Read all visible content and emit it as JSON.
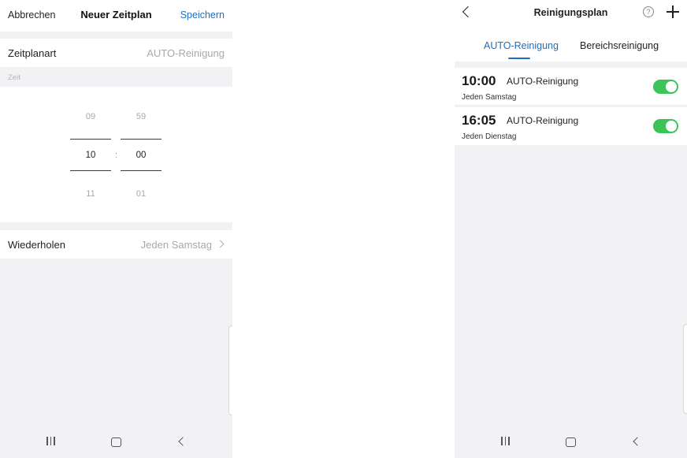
{
  "left": {
    "header": {
      "cancel": "Abbrechen",
      "title": "Neuer Zeitplan",
      "save": "Speichern"
    },
    "schedule_type": {
      "label": "Zeitplanart",
      "value": "AUTO-Reinigung"
    },
    "time_section_label": "Zeit",
    "time_picker": {
      "hours": {
        "prev": "09",
        "selected": "10",
        "next": "11"
      },
      "separator": ":",
      "minutes": {
        "prev": "59",
        "selected": "00",
        "next": "01"
      }
    },
    "repeat": {
      "label": "Wiederholen",
      "value": "Jeden Samstag"
    }
  },
  "right": {
    "header": {
      "title": "Reinigungsplan",
      "help_symbol": "?"
    },
    "tabs": [
      {
        "label": "AUTO-Reinigung",
        "active": true
      },
      {
        "label": "Bereichsreinigung",
        "active": false
      }
    ],
    "schedules": [
      {
        "time": "10:00",
        "mode": "AUTO-Reinigung",
        "repeat": "Jeden Samstag",
        "enabled": true
      },
      {
        "time": "16:05",
        "mode": "AUTO-Reinigung",
        "repeat": "Jeden Dienstag",
        "enabled": true
      }
    ]
  },
  "colors": {
    "accent": "#1f6fbf",
    "toggle_on": "#3cc45a",
    "background_gray": "#f2f2f4"
  },
  "icons": [
    "back-arrow-icon",
    "help-icon",
    "plus-icon",
    "chevron-right-icon",
    "recent-apps-icon",
    "home-icon",
    "back-icon"
  ]
}
